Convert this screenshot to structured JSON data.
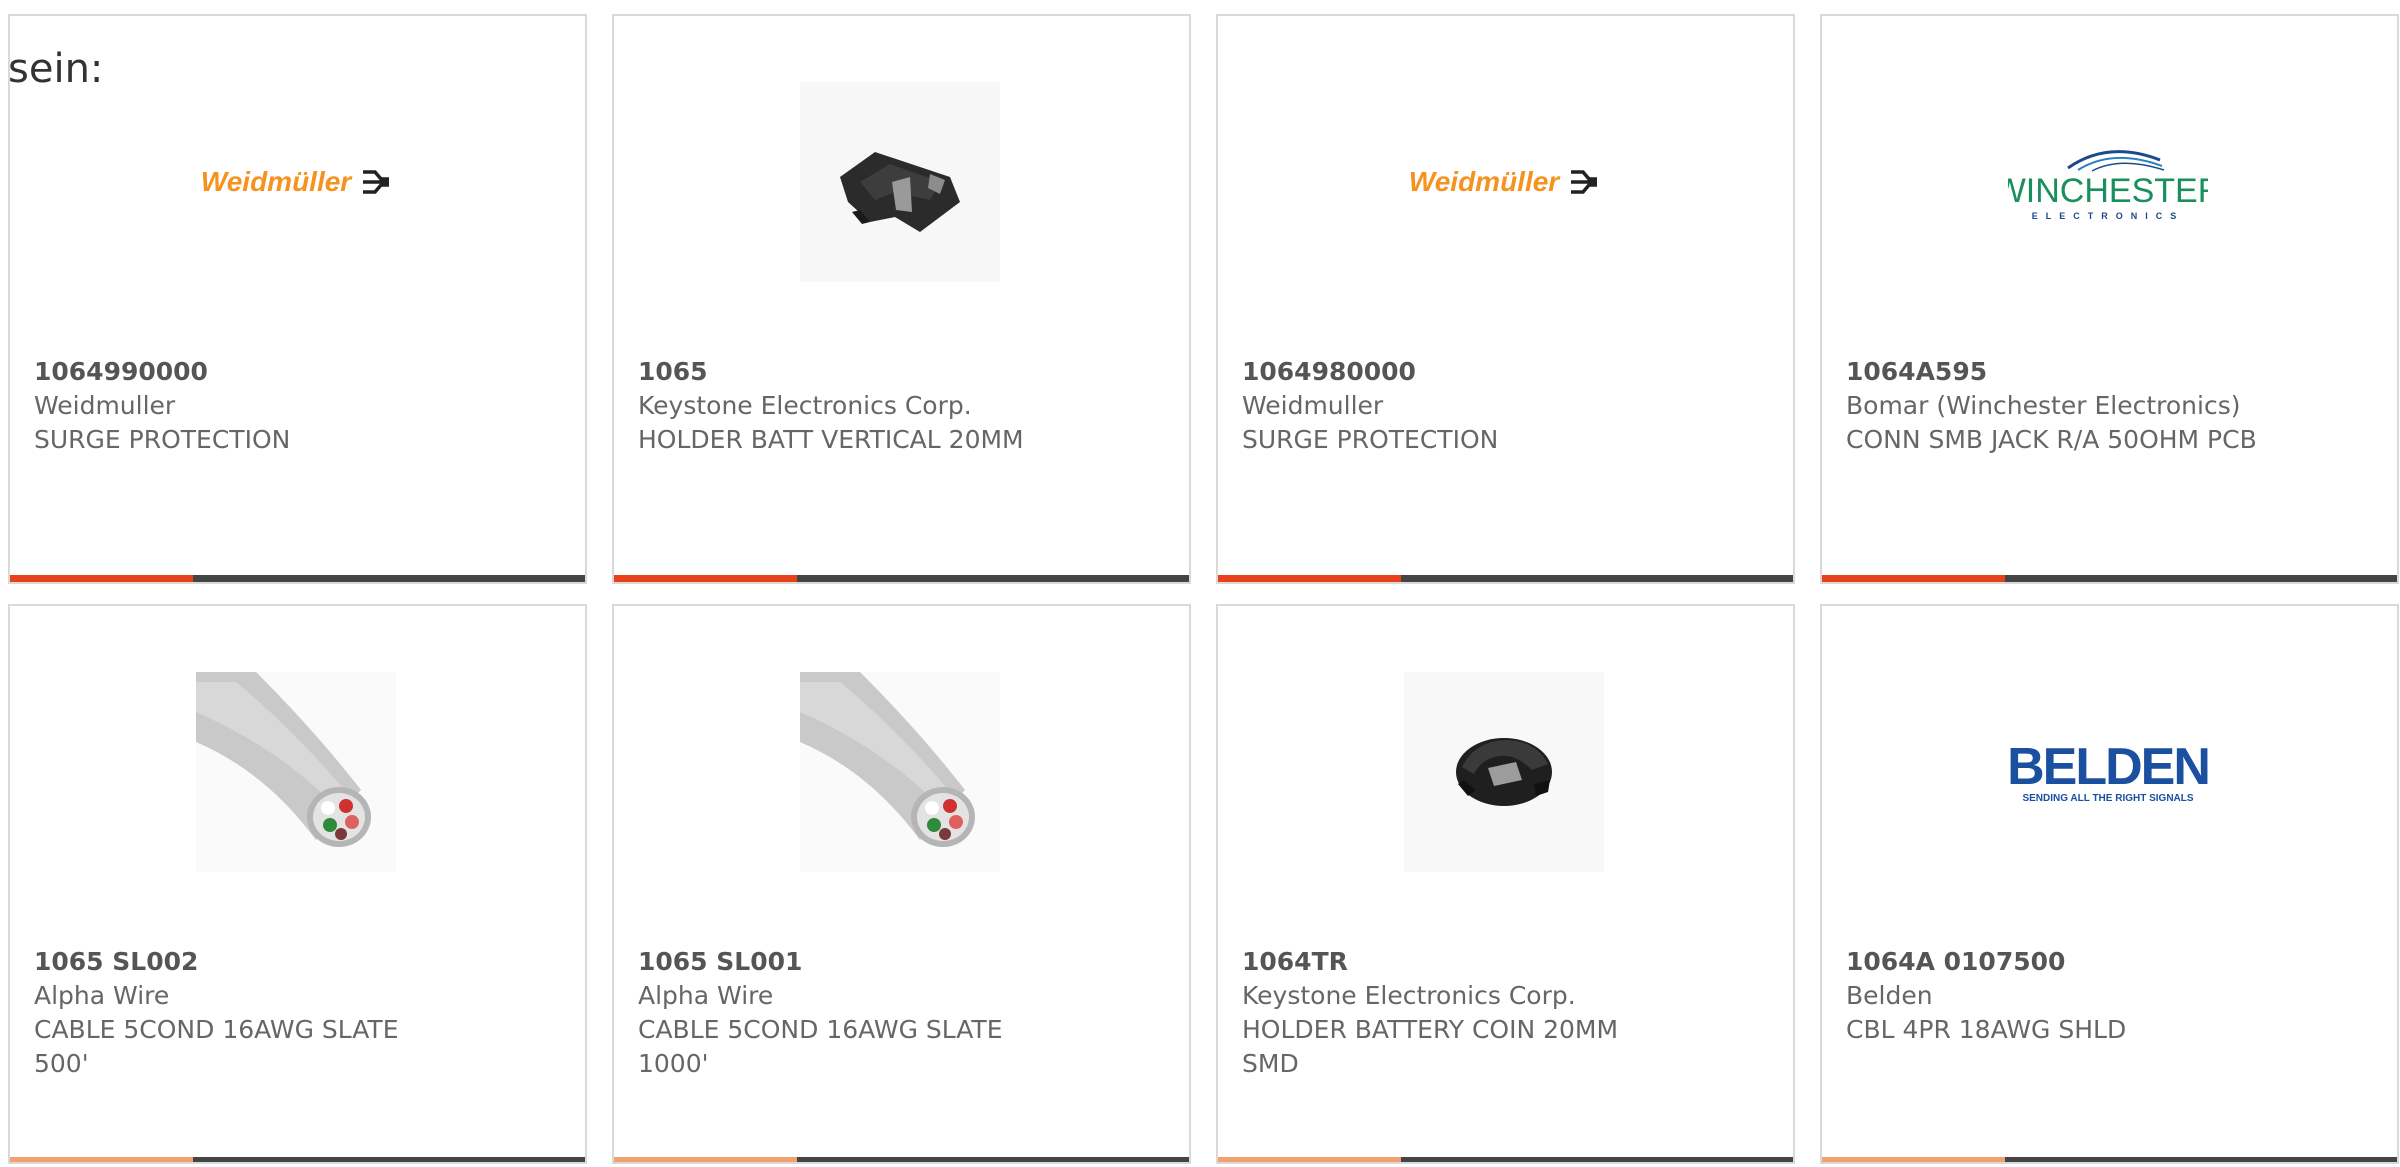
{
  "overlay_text": "sein:",
  "products": [
    {
      "part_number": "1064990000",
      "manufacturer": "Weidmuller",
      "description": "SURGE PROTECTION",
      "image": "weidmuller-logo",
      "logo_text": "Weidmüller"
    },
    {
      "part_number": "1065",
      "manufacturer": "Keystone Electronics Corp.",
      "description": "HOLDER BATT VERTICAL 20MM",
      "image": "battery-holder-vertical"
    },
    {
      "part_number": "1064980000",
      "manufacturer": "Weidmuller",
      "description": "SURGE PROTECTION",
      "image": "weidmuller-logo",
      "logo_text": "Weidmüller"
    },
    {
      "part_number": "1064A595",
      "manufacturer": "Bomar (Winchester Electronics)",
      "description": "CONN SMB JACK R/A 50OHM PCB",
      "image": "winchester-logo",
      "logo_text": "WINCHESTER",
      "logo_subtext": "ELECTRONICS"
    },
    {
      "part_number": "1065 SL002",
      "manufacturer": "Alpha Wire",
      "description": "CABLE 5COND 16AWG SLATE 500'",
      "image": "gray-cable"
    },
    {
      "part_number": "1065 SL001",
      "manufacturer": "Alpha Wire",
      "description": "CABLE 5COND 16AWG SLATE 1000'",
      "image": "gray-cable"
    },
    {
      "part_number": "1064TR",
      "manufacturer": "Keystone Electronics Corp.",
      "description": "HOLDER BATTERY COIN 20MM SMD",
      "image": "coin-battery-holder"
    },
    {
      "part_number": "1064A 0107500",
      "manufacturer": "Belden",
      "description": "CBL 4PR 18AWG SHLD",
      "image": "belden-logo",
      "logo_text": "BELDEN",
      "logo_subtext": "SENDING ALL THE RIGHT SIGNALS"
    }
  ],
  "colors": {
    "accent": "#e8411c",
    "bar": "#444444",
    "border": "#d9d9d9",
    "weidmuller_orange": "#f6921e",
    "winchester_green": "#1a8f5e",
    "belden_blue": "#1b4fa0"
  }
}
